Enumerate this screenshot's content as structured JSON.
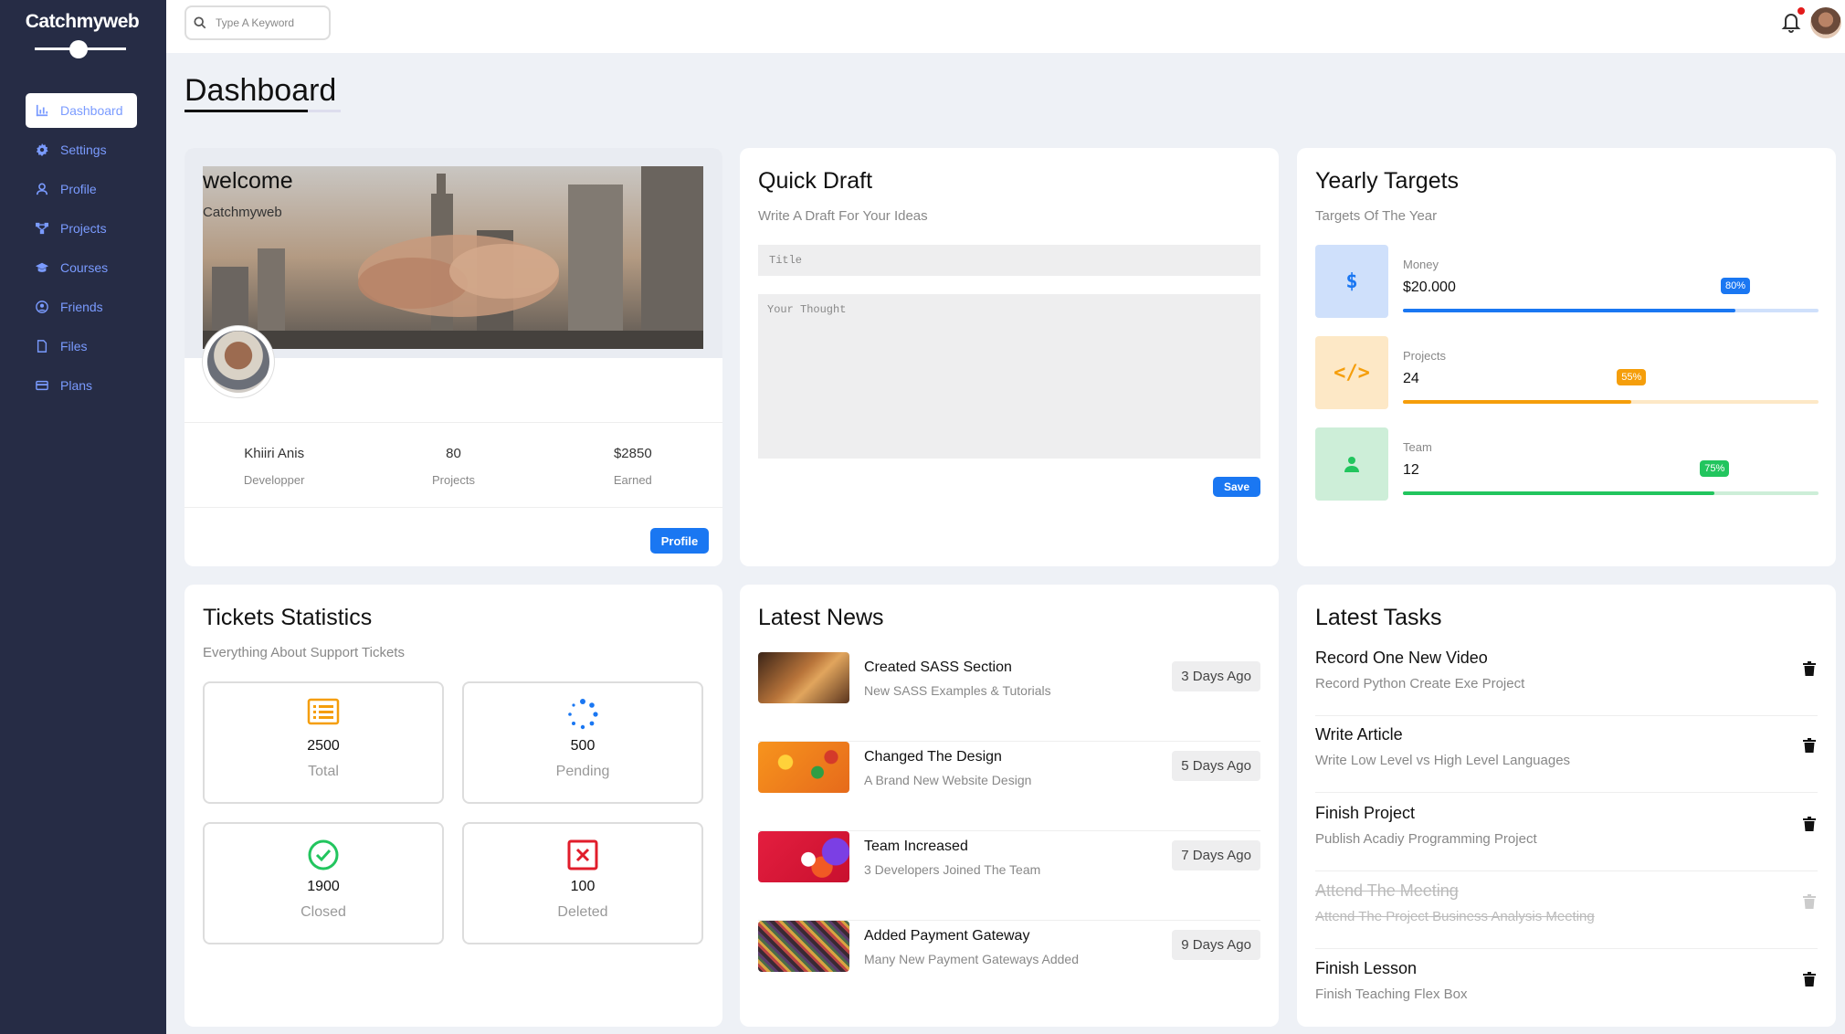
{
  "app": {
    "brand": "Catchmyweb"
  },
  "sidebar": {
    "items": [
      {
        "label": "Dashboard",
        "icon": "chart-icon",
        "active": true
      },
      {
        "label": "Settings",
        "icon": "gear-icon"
      },
      {
        "label": "Profile",
        "icon": "user-icon"
      },
      {
        "label": "Projects",
        "icon": "diagram-icon"
      },
      {
        "label": "Courses",
        "icon": "graduation-cap-icon"
      },
      {
        "label": "Friends",
        "icon": "circle-user-icon"
      },
      {
        "label": "Files",
        "icon": "file-icon"
      },
      {
        "label": "Plans",
        "icon": "credit-card-icon"
      }
    ]
  },
  "topbar": {
    "search_placeholder": "Type A Keyword"
  },
  "page": {
    "title": "Dashboard"
  },
  "welcome": {
    "title": "welcome",
    "subtitle": "Catchmyweb",
    "stats": [
      {
        "value": "Khiiri Anis",
        "label": "Developper"
      },
      {
        "value": "80",
        "label": "Projects"
      },
      {
        "value": "$2850",
        "label": "Earned"
      }
    ],
    "button": "Profile"
  },
  "quick_draft": {
    "title": "Quick Draft",
    "subtitle": "Write A Draft For Your Ideas",
    "title_placeholder": "Title",
    "body_placeholder": "Your Thought",
    "button": "Save"
  },
  "yearly_targets": {
    "title": "Yearly Targets",
    "subtitle": "Targets Of The Year",
    "targets": [
      {
        "label": "Money",
        "value": "$20.000",
        "percent": 80,
        "badge": "80%",
        "color": "#1a77f2",
        "bg": "#cfe0fb",
        "icon": "$"
      },
      {
        "label": "Projects",
        "value": "24",
        "percent": 55,
        "badge": "55%",
        "color": "#f59e0b",
        "bg": "#fde8c6",
        "icon": "</>"
      },
      {
        "label": "Team",
        "value": "12",
        "percent": 75,
        "badge": "75%",
        "color": "#22c55e",
        "bg": "#cdeed8",
        "icon": "person"
      }
    ]
  },
  "tickets": {
    "title": "Tickets Statistics",
    "subtitle": "Everything About Support Tickets",
    "items": [
      {
        "value": "2500",
        "label": "Total",
        "icon": "list-icon",
        "color": "#f59e0b"
      },
      {
        "value": "500",
        "label": "Pending",
        "icon": "spinner-icon",
        "color": "#1a77f2"
      },
      {
        "value": "1900",
        "label": "Closed",
        "icon": "check-circle-icon",
        "color": "#22c55e"
      },
      {
        "value": "100",
        "label": "Deleted",
        "icon": "x-square-icon",
        "color": "#e11d2b"
      }
    ]
  },
  "news": {
    "title": "Latest News",
    "items": [
      {
        "title": "Created SASS Section",
        "desc": "New SASS Examples & Tutorials",
        "time": "3 Days Ago"
      },
      {
        "title": "Changed The Design",
        "desc": "A Brand New Website Design",
        "time": "5 Days Ago"
      },
      {
        "title": "Team Increased",
        "desc": "3 Developers Joined The Team",
        "time": "7 Days Ago"
      },
      {
        "title": "Added Payment Gateway",
        "desc": "Many New Payment Gateways Added",
        "time": "9 Days Ago"
      }
    ]
  },
  "tasks": {
    "title": "Latest Tasks",
    "items": [
      {
        "title": "Record One New Video",
        "desc": "Record Python Create Exe Project",
        "done": false
      },
      {
        "title": "Write Article",
        "desc": "Write Low Level vs High Level Languages",
        "done": false
      },
      {
        "title": "Finish Project",
        "desc": "Publish Acadiy Programming Project",
        "done": false
      },
      {
        "title": "Attend The Meeting",
        "desc": "Attend The Project Business Analysis Meeting",
        "done": true
      },
      {
        "title": "Finish Lesson",
        "desc": "Finish Teaching Flex Box",
        "done": false
      }
    ]
  }
}
